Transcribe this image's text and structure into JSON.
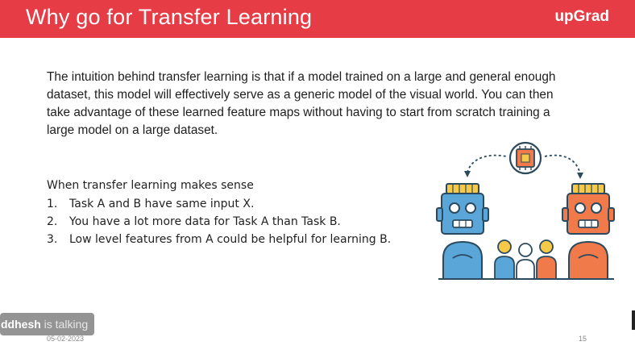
{
  "header": {
    "title": "Why go for Transfer Learning",
    "brand": "upGrad"
  },
  "intro": {
    "paragraph": "The intuition behind transfer learning is that if a model trained on a large and general enough dataset, this model will effectively serve as a generic model of the visual world. You can then take advantage of these learned feature maps without having to start from scratch training a large model on a large dataset."
  },
  "when_sense": {
    "heading": "When transfer learning makes sense",
    "items": [
      {
        "num": "1.",
        "text": "Task A and B have same input X."
      },
      {
        "num": "2.",
        "text": "You have a lot more data for Task A than Task B."
      },
      {
        "num": "3.",
        "text": "Low level features from A could be helpful for learning B."
      }
    ]
  },
  "illustration": {
    "icon": "robots-transfer-illustration",
    "colors": {
      "robot_left": "#5aa6d8",
      "robot_right": "#f07a4a",
      "outline": "#2c4a5e",
      "accent": "#f7c948"
    }
  },
  "speaker": {
    "name": "ddhesh",
    "status": " is talking"
  },
  "footer": {
    "date": "05-02-2023",
    "page": "15"
  },
  "colors": {
    "header_bg": "#e63c46",
    "header_text": "#ffffff"
  }
}
